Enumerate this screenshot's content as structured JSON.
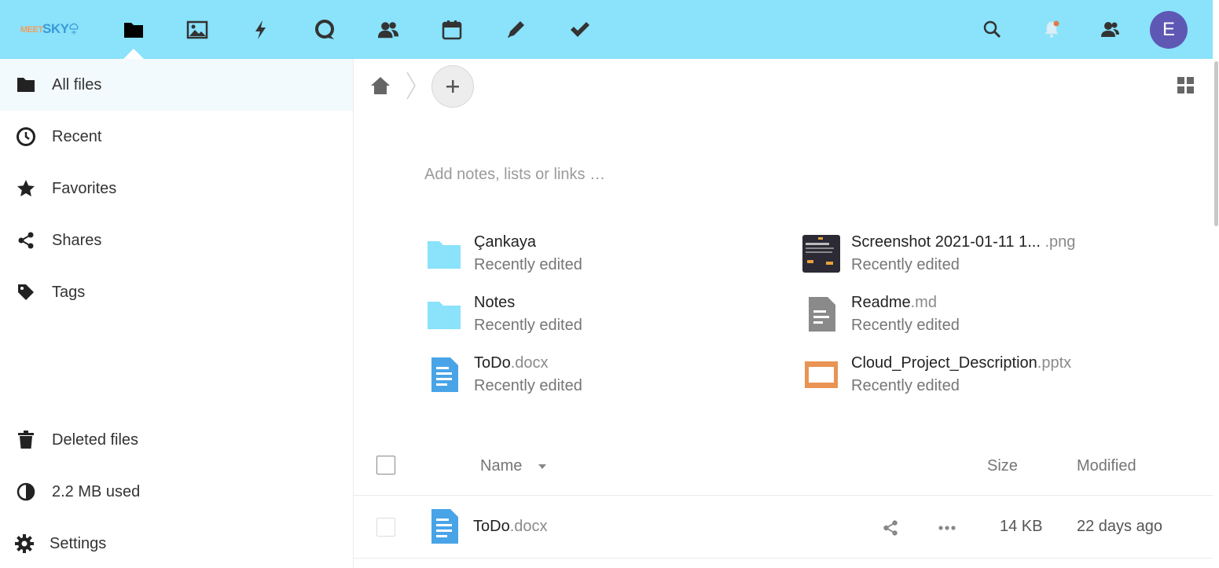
{
  "brand": {
    "logo_text_meet": "MEET",
    "logo_text_sky": "SKY",
    "accent_color": "#8ae2fb",
    "avatar_color": "#5e58b4"
  },
  "header": {
    "apps": [
      {
        "name": "files-icon"
      },
      {
        "name": "photos-icon"
      },
      {
        "name": "activity-icon"
      },
      {
        "name": "talk-icon"
      },
      {
        "name": "contacts-icon"
      },
      {
        "name": "calendar-icon"
      },
      {
        "name": "notes-icon"
      },
      {
        "name": "tasks-icon"
      }
    ],
    "avatar_initial": "E"
  },
  "sidebar": {
    "items": [
      {
        "label": "All files",
        "icon": "folder-icon"
      },
      {
        "label": "Recent",
        "icon": "clock-icon"
      },
      {
        "label": "Favorites",
        "icon": "star-icon"
      },
      {
        "label": "Shares",
        "icon": "share-icon"
      },
      {
        "label": "Tags",
        "icon": "tag-icon"
      }
    ],
    "bottom": [
      {
        "label": "Deleted files",
        "icon": "trash-icon"
      },
      {
        "label": "2.2 MB used",
        "icon": "quota-pie-icon"
      },
      {
        "label": "Settings",
        "icon": "gear-icon"
      }
    ]
  },
  "main": {
    "notes_placeholder": "Add notes, lists or links …",
    "recent": [
      {
        "name": "Çankaya",
        "ext": "",
        "sub": "Recently edited",
        "type": "folder"
      },
      {
        "name": "Screenshot 2021-01-11 1... ",
        "ext": ".png",
        "sub": "Recently edited",
        "type": "image"
      },
      {
        "name": "Notes",
        "ext": "",
        "sub": "Recently edited",
        "type": "folder"
      },
      {
        "name": "Readme",
        "ext": ".md",
        "sub": "Recently edited",
        "type": "text"
      },
      {
        "name": "ToDo",
        "ext": ".docx",
        "sub": "Recently edited",
        "type": "document"
      },
      {
        "name": "Cloud_Project_Description",
        "ext": ".pptx",
        "sub": "Recently edited",
        "type": "presentation"
      }
    ],
    "table": {
      "headers": {
        "name": "Name",
        "size": "Size",
        "modified": "Modified"
      },
      "rows": [
        {
          "name": "ToDo",
          "ext": ".docx",
          "size": "14 KB",
          "modified": "22 days ago"
        }
      ]
    }
  }
}
